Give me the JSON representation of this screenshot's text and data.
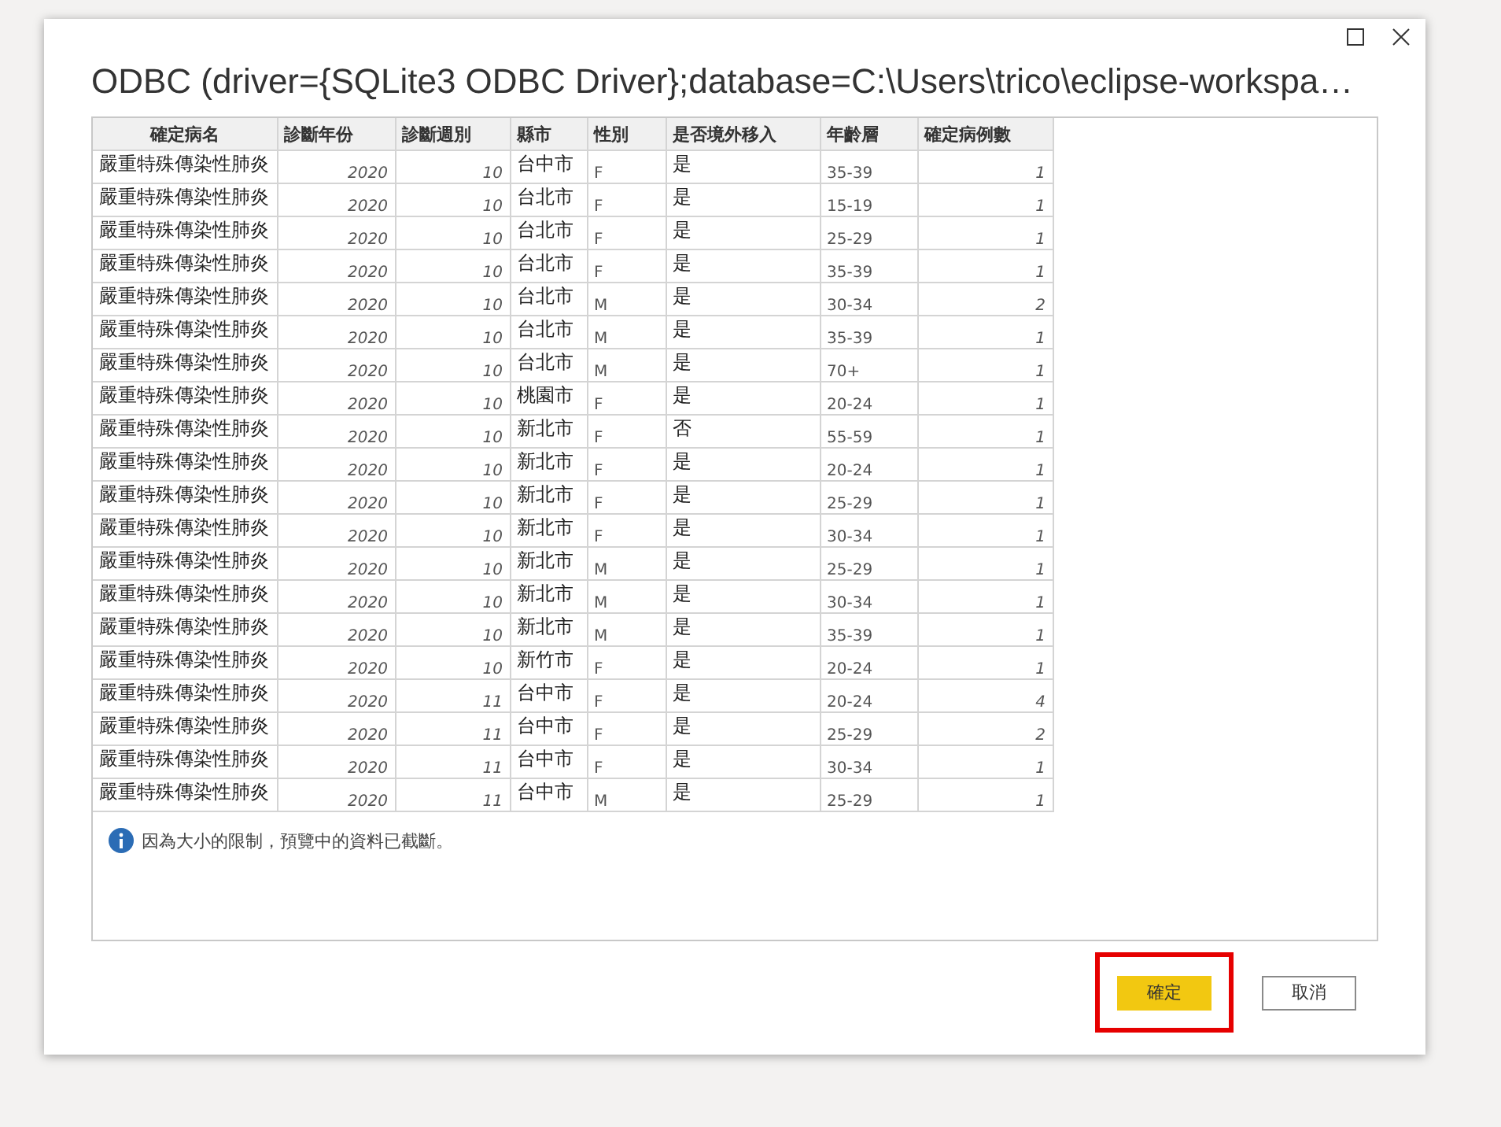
{
  "window": {
    "title": "ODBC (driver={SQLite3 ODBC Driver};database=C:\\Users\\trico\\eclipse-workspa…"
  },
  "table": {
    "columns": [
      {
        "label": "確定病名",
        "kind": "text"
      },
      {
        "label": "診斷年份",
        "kind": "number"
      },
      {
        "label": "診斷週別",
        "kind": "number"
      },
      {
        "label": "縣市",
        "kind": "text"
      },
      {
        "label": "性別",
        "kind": "code"
      },
      {
        "label": "是否境外移入",
        "kind": "text"
      },
      {
        "label": "年齡層",
        "kind": "code"
      },
      {
        "label": "確定病例數",
        "kind": "number"
      }
    ],
    "rows": [
      [
        "嚴重特殊傳染性肺炎",
        "2020",
        "10",
        "台中市",
        "F",
        "是",
        "35-39",
        "1"
      ],
      [
        "嚴重特殊傳染性肺炎",
        "2020",
        "10",
        "台北市",
        "F",
        "是",
        "15-19",
        "1"
      ],
      [
        "嚴重特殊傳染性肺炎",
        "2020",
        "10",
        "台北市",
        "F",
        "是",
        "25-29",
        "1"
      ],
      [
        "嚴重特殊傳染性肺炎",
        "2020",
        "10",
        "台北市",
        "F",
        "是",
        "35-39",
        "1"
      ],
      [
        "嚴重特殊傳染性肺炎",
        "2020",
        "10",
        "台北市",
        "M",
        "是",
        "30-34",
        "2"
      ],
      [
        "嚴重特殊傳染性肺炎",
        "2020",
        "10",
        "台北市",
        "M",
        "是",
        "35-39",
        "1"
      ],
      [
        "嚴重特殊傳染性肺炎",
        "2020",
        "10",
        "台北市",
        "M",
        "是",
        "70+",
        "1"
      ],
      [
        "嚴重特殊傳染性肺炎",
        "2020",
        "10",
        "桃園市",
        "F",
        "是",
        "20-24",
        "1"
      ],
      [
        "嚴重特殊傳染性肺炎",
        "2020",
        "10",
        "新北市",
        "F",
        "否",
        "55-59",
        "1"
      ],
      [
        "嚴重特殊傳染性肺炎",
        "2020",
        "10",
        "新北市",
        "F",
        "是",
        "20-24",
        "1"
      ],
      [
        "嚴重特殊傳染性肺炎",
        "2020",
        "10",
        "新北市",
        "F",
        "是",
        "25-29",
        "1"
      ],
      [
        "嚴重特殊傳染性肺炎",
        "2020",
        "10",
        "新北市",
        "F",
        "是",
        "30-34",
        "1"
      ],
      [
        "嚴重特殊傳染性肺炎",
        "2020",
        "10",
        "新北市",
        "M",
        "是",
        "25-29",
        "1"
      ],
      [
        "嚴重特殊傳染性肺炎",
        "2020",
        "10",
        "新北市",
        "M",
        "是",
        "30-34",
        "1"
      ],
      [
        "嚴重特殊傳染性肺炎",
        "2020",
        "10",
        "新北市",
        "M",
        "是",
        "35-39",
        "1"
      ],
      [
        "嚴重特殊傳染性肺炎",
        "2020",
        "10",
        "新竹市",
        "F",
        "是",
        "20-24",
        "1"
      ],
      [
        "嚴重特殊傳染性肺炎",
        "2020",
        "11",
        "台中市",
        "F",
        "是",
        "20-24",
        "4"
      ],
      [
        "嚴重特殊傳染性肺炎",
        "2020",
        "11",
        "台中市",
        "F",
        "是",
        "25-29",
        "2"
      ],
      [
        "嚴重特殊傳染性肺炎",
        "2020",
        "11",
        "台中市",
        "F",
        "是",
        "30-34",
        "1"
      ],
      [
        "嚴重特殊傳染性肺炎",
        "2020",
        "11",
        "台中市",
        "M",
        "是",
        "25-29",
        "1"
      ]
    ]
  },
  "notice": "因為大小的限制，預覽中的資料已截斷。",
  "buttons": [
    {
      "label": "確定",
      "kind": "primary",
      "highlighted": true
    },
    {
      "label": "取消",
      "kind": "secondary",
      "highlighted": false
    }
  ]
}
